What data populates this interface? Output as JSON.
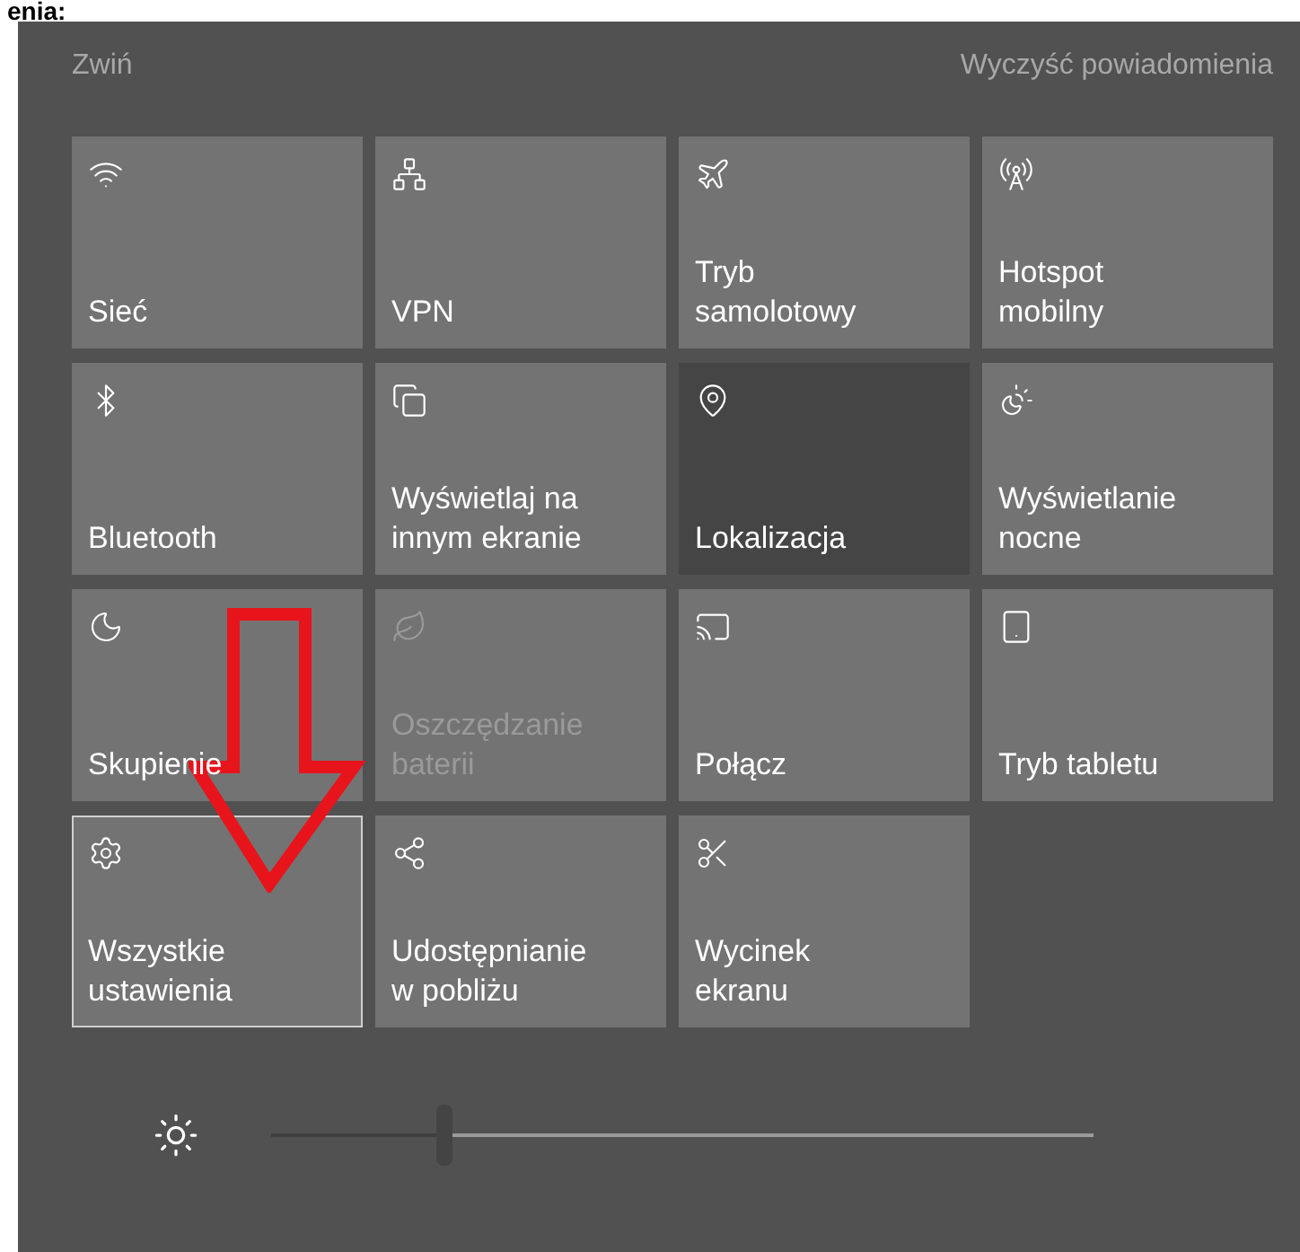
{
  "caption": "enia:",
  "header": {
    "collapse": "Zwiń",
    "clear": "Wyczyść powiadomienia"
  },
  "tiles": [
    {
      "label": "Sieć",
      "active": true,
      "disabled": false,
      "selected": false
    },
    {
      "label": "VPN",
      "active": true,
      "disabled": false,
      "selected": false
    },
    {
      "label": "Tryb samolotowy",
      "active": true,
      "disabled": false,
      "selected": false
    },
    {
      "label": "Hotspot mobilny",
      "active": true,
      "disabled": false,
      "selected": false
    },
    {
      "label": "Bluetooth",
      "active": true,
      "disabled": false,
      "selected": false
    },
    {
      "label": "Wyświetlaj na innym ekranie",
      "active": true,
      "disabled": false,
      "selected": false
    },
    {
      "label": "Lokalizacja",
      "active": false,
      "disabled": false,
      "selected": false
    },
    {
      "label": "Wyświetlanie nocne",
      "active": true,
      "disabled": false,
      "selected": false
    },
    {
      "label": "Skupienie",
      "active": true,
      "disabled": false,
      "selected": false
    },
    {
      "label": "Oszczędzanie baterii",
      "active": true,
      "disabled": true,
      "selected": false
    },
    {
      "label": "Połącz",
      "active": true,
      "disabled": false,
      "selected": false
    },
    {
      "label": "Tryb tabletu",
      "active": true,
      "disabled": false,
      "selected": false
    },
    {
      "label": "Wszystkie ustawienia",
      "active": true,
      "disabled": false,
      "selected": true
    },
    {
      "label": "Udostępnianie w pobliżu",
      "active": true,
      "disabled": false,
      "selected": false
    },
    {
      "label": "Wycinek ekranu",
      "active": true,
      "disabled": false,
      "selected": false
    }
  ],
  "brightness": {
    "level": 0.21
  }
}
